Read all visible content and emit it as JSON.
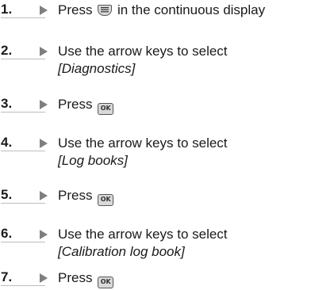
{
  "steps": [
    {
      "number": "1.",
      "before": "Press",
      "key": "menu-key-icon",
      "after": "in the continuous display"
    },
    {
      "number": "2.",
      "line1": "Use the arrow keys to select",
      "line2": "[Diagnostics]"
    },
    {
      "number": "3.",
      "before": "Press",
      "key": "ok-key-icon",
      "key_label": "OK"
    },
    {
      "number": "4.",
      "line1": "Use the arrow keys to select",
      "line2": "[Log books]"
    },
    {
      "number": "5.",
      "before": "Press",
      "key": "ok-key-icon",
      "key_label": "OK"
    },
    {
      "number": "6.",
      "line1": "Use the arrow keys to select",
      "line2": "[Calibration log book]"
    },
    {
      "number": "7.",
      "before": "Press",
      "key": "ok-key-icon",
      "key_label": "OK"
    }
  ]
}
